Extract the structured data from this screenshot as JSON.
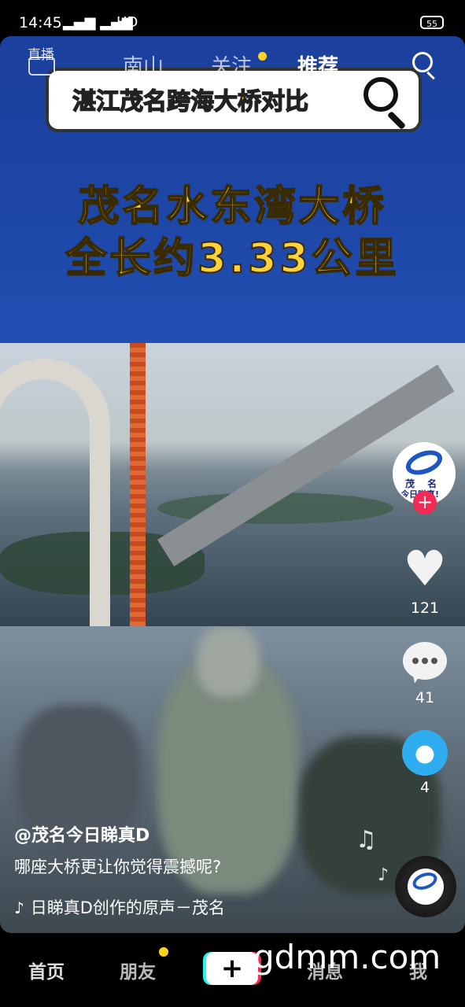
{
  "status_bar": {
    "time": "14:45",
    "signal": "4G ull 4G ull",
    "network": "HD",
    "battery": "55"
  },
  "top_nav": {
    "live": "直播",
    "tabs": [
      {
        "label": "南山"
      },
      {
        "label": "关注"
      },
      {
        "label": "推荐"
      }
    ]
  },
  "video": {
    "banner_title": "湛江茂名跨海大桥对比",
    "headline_line1": "茂名水东湾大桥",
    "headline_line2": "全长约3.33公里"
  },
  "side_rail": {
    "likes": "121",
    "comments": "41",
    "shares": "4",
    "avatar_text1": "茂 名",
    "avatar_text2": "今日睇真!"
  },
  "caption": {
    "author": "@茂名今日睇真D",
    "description": "哪座大桥更让你觉得震撼呢?",
    "music": "日睇真D创作的原声－茂名"
  },
  "bottom_nav": {
    "home": "首页",
    "friends": "朋友",
    "messages": "消息",
    "me": "我",
    "create": "+"
  },
  "watermark": "gdmm.com",
  "colors": {
    "accent_red": "#f02c56",
    "notify_yellow": "#ffd21f",
    "share_blue": "#2eaef0",
    "headline_yellow": "#ffd23a"
  }
}
